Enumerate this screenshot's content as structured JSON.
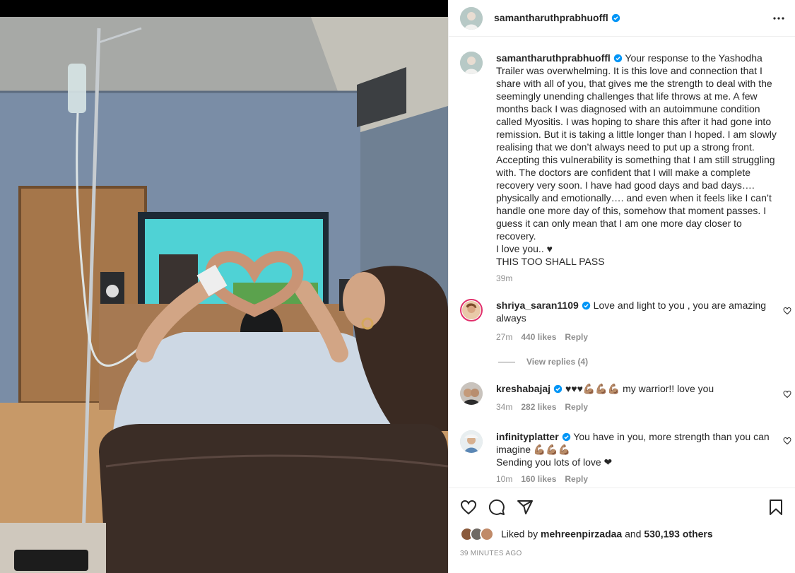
{
  "post": {
    "username": "samantharuthprabhuoffl",
    "verified": true,
    "caption": "Your response to the Yashodha Trailer was overwhelming. It is this love and connection that I share with all of you, that gives me the strength to deal with the seemingly unending challenges that life throws at me. A few months back I was diagnosed with an autoimmune condition called Myositis. I was hoping to share this after it had gone into remission. But it is taking a little longer than I hoped. I am slowly realising that we don’t always need to put up a strong front. Accepting this vulnerability is something that I am still struggling with. The doctors are confident that I will make a complete recovery very soon. I have had good days and bad days…. physically and emotionally…. and even when it feels like I can’t handle one more day of this, somehow that moment passes. I guess it can only mean that I am one more day closer to recovery.\nI love you.. ♥\nTHIS TOO SHALL PASS",
    "caption_time": "39m"
  },
  "comments": [
    {
      "username": "shriya_saran1109",
      "verified": true,
      "text": "Love and light to you , you are amazing always",
      "time": "27m",
      "likes": "440 likes",
      "reply": "Reply",
      "view_replies": "View replies (4)"
    },
    {
      "username": "kreshabajaj",
      "verified": true,
      "text": "♥♥♥💪🏽💪🏽💪🏽 my warrior!! love you",
      "time": "34m",
      "likes": "282 likes",
      "reply": "Reply"
    },
    {
      "username": "infinityplatter",
      "verified": true,
      "text": "You have in you, more strength than you can imagine 💪🏽💪🏽💪🏽",
      "text2": "Sending you lots of love ❤",
      "time": "10m",
      "likes": "160 likes",
      "reply": "Reply"
    }
  ],
  "footer": {
    "liked_by_prefix": "Liked by",
    "liked_by_user": "mehreenpirzadaa",
    "liked_by_and": "and",
    "liked_by_others": "530,193 others",
    "timestamp": "39 MINUTES AGO"
  },
  "icons": [
    "more-options-icon",
    "heart-icon",
    "comment-icon",
    "share-icon",
    "bookmark-icon",
    "verified-badge-icon"
  ],
  "colors": {
    "verified_blue": "#0095f6",
    "story_ring": "#e1306c",
    "muted_text": "#8e8e8e"
  }
}
